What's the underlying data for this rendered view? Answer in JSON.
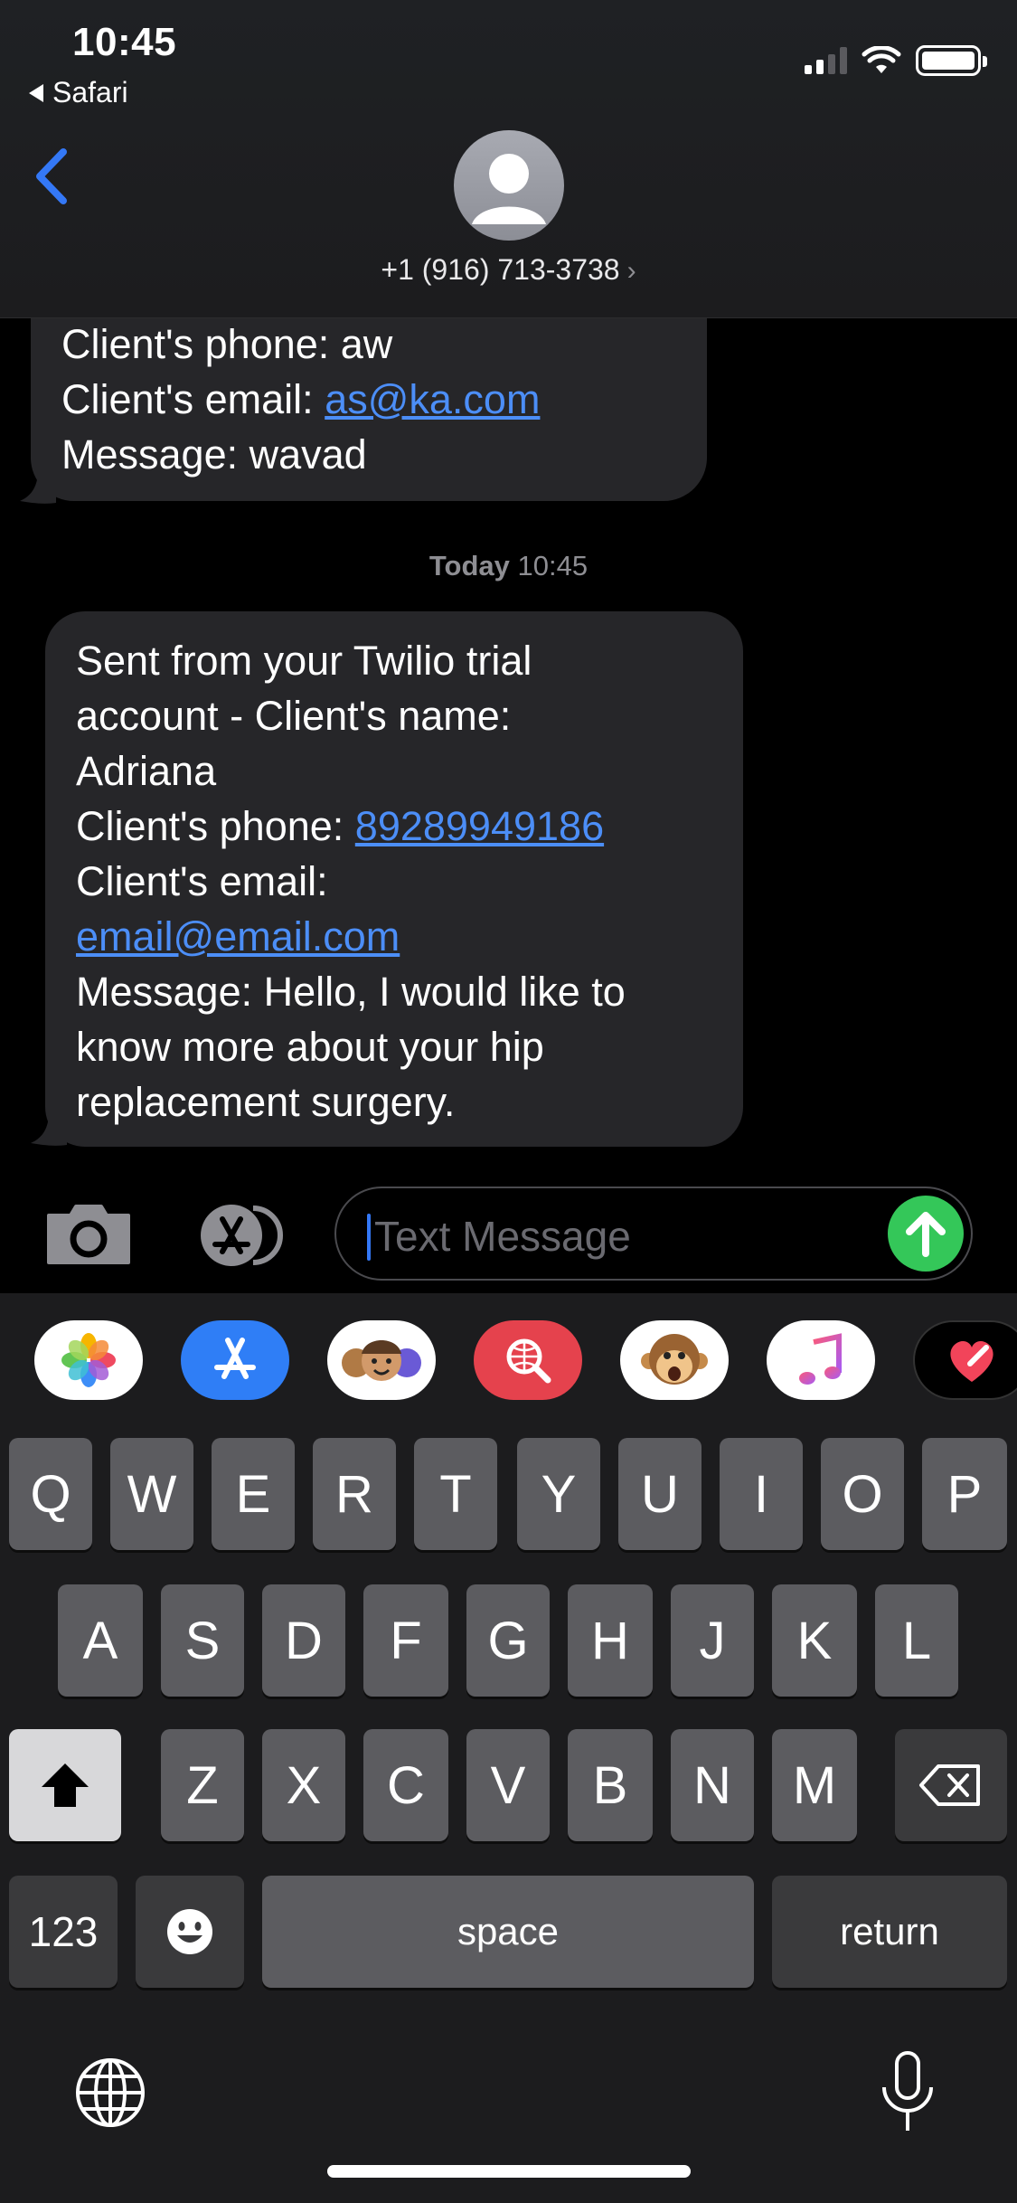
{
  "status_bar": {
    "time": "10:45",
    "back_app": "Safari"
  },
  "header": {
    "contact": "+1 (916) 713-3738",
    "chevron": "›"
  },
  "messages": [
    {
      "line1": "Client's phone: aw",
      "line2_label": "Client's email: ",
      "line2_link": "as@ka.com",
      "line3": "Message: wavad"
    },
    {
      "line1": "Sent from your Twilio trial",
      "line2": "account - Client's name:",
      "line3": "Adriana",
      "line4_label": "Client's phone: ",
      "line4_link": "89289949186",
      "line5": "Client's email:",
      "line6_link": "email@email.com",
      "line7": "Message: Hello, I would like to",
      "line8": "know more about your hip",
      "line9": "replacement surgery."
    }
  ],
  "timestamp": {
    "day": "Today",
    "time": "10:45"
  },
  "input": {
    "placeholder": "Text Message"
  },
  "app_strip": [
    "photos-icon",
    "app-store-icon",
    "memoji-icon",
    "image-search-icon",
    "animoji-monkey-icon",
    "music-icon",
    "digital-touch-icon"
  ],
  "keyboard": {
    "row1": [
      "Q",
      "W",
      "E",
      "R",
      "T",
      "Y",
      "U",
      "I",
      "O",
      "P"
    ],
    "row2": [
      "A",
      "S",
      "D",
      "F",
      "G",
      "H",
      "J",
      "K",
      "L"
    ],
    "row3": [
      "Z",
      "X",
      "C",
      "V",
      "B",
      "N",
      "M"
    ],
    "numbers": "123",
    "space": "space",
    "return": "return"
  },
  "colors": {
    "link": "#4c8ef7",
    "send": "#34c759",
    "accent": "#3478f6",
    "bubble": "#262629"
  }
}
